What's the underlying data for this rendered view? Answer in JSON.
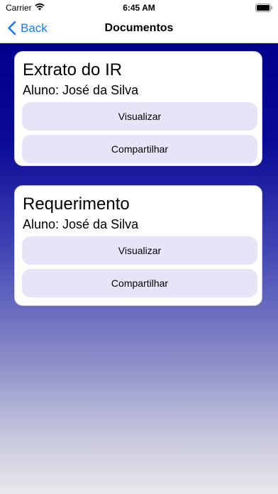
{
  "status_bar": {
    "carrier": "Carrier",
    "time": "6:45 AM"
  },
  "nav": {
    "back_label": "Back",
    "title": "Documentos"
  },
  "cards": [
    {
      "title": "Extrato do IR",
      "subtitle": "Aluno: José da Silva",
      "view_label": "Visualizar",
      "share_label": "Compartilhar"
    },
    {
      "title": "Requerimento",
      "subtitle": "Aluno: José da Silva",
      "view_label": "Visualizar",
      "share_label": "Compartilhar"
    }
  ],
  "colors": {
    "accent": "#1a7cf0",
    "background_top": "#00008b",
    "button_fill": "#e5e5f7"
  },
  "icons": {
    "wifi": "wifi-icon",
    "battery": "battery-icon",
    "back": "chevron-left-icon"
  }
}
